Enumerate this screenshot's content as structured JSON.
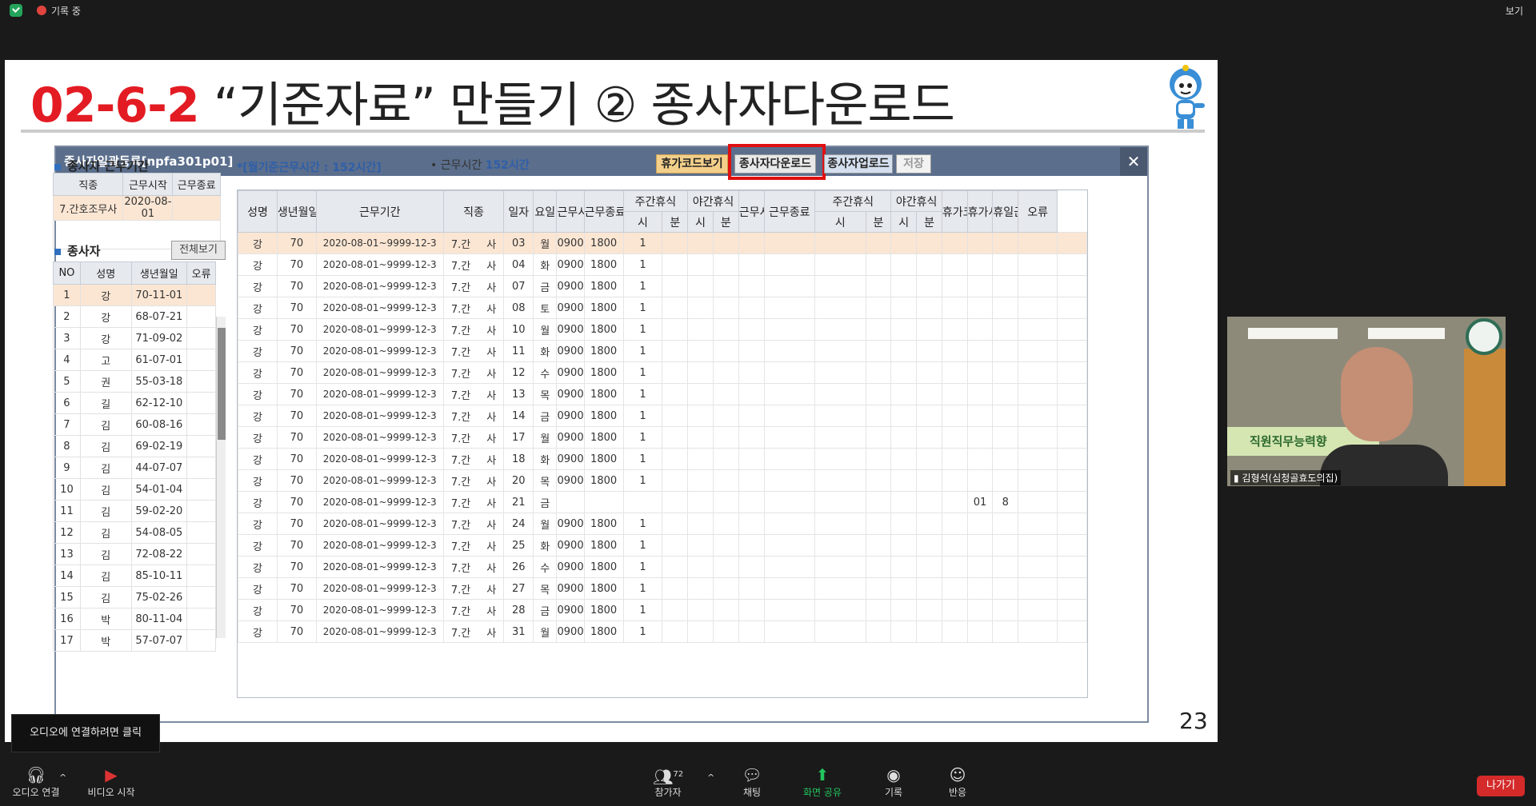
{
  "topbar": {
    "recording": "기록 중",
    "view": "보기"
  },
  "slide": {
    "title_num": "02-6-2",
    "title_rest": " “기준자료” 만들기 ② 종사자다운로드",
    "page": "23"
  },
  "window": {
    "title": "종사자일괄등록[npfa301p01]",
    "close": "✕"
  },
  "period": {
    "section": "종사자 근무기간",
    "headers": [
      "직종",
      "근무시작",
      "근무종료"
    ],
    "row": [
      "7.간호조무사",
      "2020-08-01",
      ""
    ]
  },
  "staff": {
    "section": "종사자",
    "view_all": "전체보기",
    "headers": [
      "NO",
      "성명",
      "생년월일",
      "오류"
    ],
    "rows": [
      [
        "1",
        "강",
        "70-11-01",
        ""
      ],
      [
        "2",
        "강",
        "68-07-21",
        ""
      ],
      [
        "3",
        "강",
        "71-09-02",
        ""
      ],
      [
        "4",
        "고",
        "61-07-01",
        ""
      ],
      [
        "5",
        "권",
        "55-03-18",
        ""
      ],
      [
        "6",
        "길",
        "62-12-10",
        ""
      ],
      [
        "7",
        "김",
        "60-08-16",
        ""
      ],
      [
        "8",
        "김",
        "69-02-19",
        ""
      ],
      [
        "9",
        "김",
        "44-07-07",
        ""
      ],
      [
        "10",
        "김",
        "54-01-04",
        ""
      ],
      [
        "11",
        "김",
        "59-02-20",
        ""
      ],
      [
        "12",
        "김",
        "54-08-05",
        ""
      ],
      [
        "13",
        "김",
        "72-08-22",
        ""
      ],
      [
        "14",
        "김",
        "85-10-11",
        ""
      ],
      [
        "15",
        "김",
        "75-02-26",
        ""
      ],
      [
        "16",
        "박",
        "80-11-04",
        ""
      ],
      [
        "17",
        "박",
        "57-07-07",
        ""
      ]
    ]
  },
  "info": {
    "monthly": "*[월기준근무시간 : 152시간]",
    "work_label": "근무시간",
    "work_value": "152시간"
  },
  "buttons": {
    "leave_code": "휴가코드보기",
    "download": "종사자다운로드",
    "upload": "종사자업로드",
    "save": "저장"
  },
  "grid": {
    "headers": [
      "성명",
      "생년월일",
      "근무기간",
      "직종",
      "일자",
      "요일",
      "근무시작",
      "근무종료",
      "주간휴식",
      "야간휴식",
      "근무시작",
      "근무종료",
      "주간휴식",
      "야간휴식",
      "휴가코드",
      "휴가시간",
      "휴일근무시간",
      "오류"
    ],
    "sub": [
      "시",
      "분",
      "시",
      "분",
      "시",
      "분",
      "시",
      "분"
    ],
    "rows": [
      [
        "강",
        "70",
        "2020-08-01~9999-12-3",
        "7.간",
        "사",
        "03",
        "월",
        "0900",
        "1800",
        "1",
        "",
        ""
      ],
      [
        "강",
        "70",
        "2020-08-01~9999-12-3",
        "7.간",
        "사",
        "04",
        "화",
        "0900",
        "1800",
        "1",
        "",
        ""
      ],
      [
        "강",
        "70",
        "2020-08-01~9999-12-3",
        "7.간",
        "사",
        "07",
        "금",
        "0900",
        "1800",
        "1",
        "",
        ""
      ],
      [
        "강",
        "70",
        "2020-08-01~9999-12-3",
        "7.간",
        "사",
        "08",
        "토",
        "0900",
        "1800",
        "1",
        "",
        ""
      ],
      [
        "강",
        "70",
        "2020-08-01~9999-12-3",
        "7.간",
        "사",
        "10",
        "월",
        "0900",
        "1800",
        "1",
        "",
        ""
      ],
      [
        "강",
        "70",
        "2020-08-01~9999-12-3",
        "7.간",
        "사",
        "11",
        "화",
        "0900",
        "1800",
        "1",
        "",
        ""
      ],
      [
        "강",
        "70",
        "2020-08-01~9999-12-3",
        "7.간",
        "사",
        "12",
        "수",
        "0900",
        "1800",
        "1",
        "",
        ""
      ],
      [
        "강",
        "70",
        "2020-08-01~9999-12-3",
        "7.간",
        "사",
        "13",
        "목",
        "0900",
        "1800",
        "1",
        "",
        ""
      ],
      [
        "강",
        "70",
        "2020-08-01~9999-12-3",
        "7.간",
        "사",
        "14",
        "금",
        "0900",
        "1800",
        "1",
        "",
        ""
      ],
      [
        "강",
        "70",
        "2020-08-01~9999-12-3",
        "7.간",
        "사",
        "17",
        "월",
        "0900",
        "1800",
        "1",
        "",
        ""
      ],
      [
        "강",
        "70",
        "2020-08-01~9999-12-3",
        "7.간",
        "사",
        "18",
        "화",
        "0900",
        "1800",
        "1",
        "",
        ""
      ],
      [
        "강",
        "70",
        "2020-08-01~9999-12-3",
        "7.간",
        "사",
        "20",
        "목",
        "0900",
        "1800",
        "1",
        "",
        ""
      ],
      [
        "강",
        "70",
        "2020-08-01~9999-12-3",
        "7.간",
        "사",
        "21",
        "금",
        "",
        "",
        "",
        "01",
        "8"
      ],
      [
        "강",
        "70",
        "2020-08-01~9999-12-3",
        "7.간",
        "사",
        "24",
        "월",
        "0900",
        "1800",
        "1",
        "",
        ""
      ],
      [
        "강",
        "70",
        "2020-08-01~9999-12-3",
        "7.간",
        "사",
        "25",
        "화",
        "0900",
        "1800",
        "1",
        "",
        ""
      ],
      [
        "강",
        "70",
        "2020-08-01~9999-12-3",
        "7.간",
        "사",
        "26",
        "수",
        "0900",
        "1800",
        "1",
        "",
        ""
      ],
      [
        "강",
        "70",
        "2020-08-01~9999-12-3",
        "7.간",
        "사",
        "27",
        "목",
        "0900",
        "1800",
        "1",
        "",
        ""
      ],
      [
        "강",
        "70",
        "2020-08-01~9999-12-3",
        "7.간",
        "사",
        "28",
        "금",
        "0900",
        "1800",
        "1",
        "",
        ""
      ],
      [
        "강",
        "70",
        "2020-08-01~9999-12-3",
        "7.간",
        "사",
        "31",
        "월",
        "0900",
        "1800",
        "1",
        "",
        ""
      ]
    ]
  },
  "camera": {
    "banner": "직원직무능력향",
    "name": "김형석(심청골효도의집)"
  },
  "tooltip": "오디오에 연결하려면 클릭",
  "toolbar": {
    "audio": "오디오 연결",
    "video": "비디오 시작",
    "participants": "참가자",
    "participants_count": "72",
    "chat": "채팅",
    "share": "화면 공유",
    "record": "기록",
    "reactions": "반응",
    "leave": "나가기"
  },
  "colors": {
    "title_accent": "#e31b23",
    "share_green": "#22c55e",
    "leave_red": "#d42a2a",
    "highlight": "#e01010"
  }
}
